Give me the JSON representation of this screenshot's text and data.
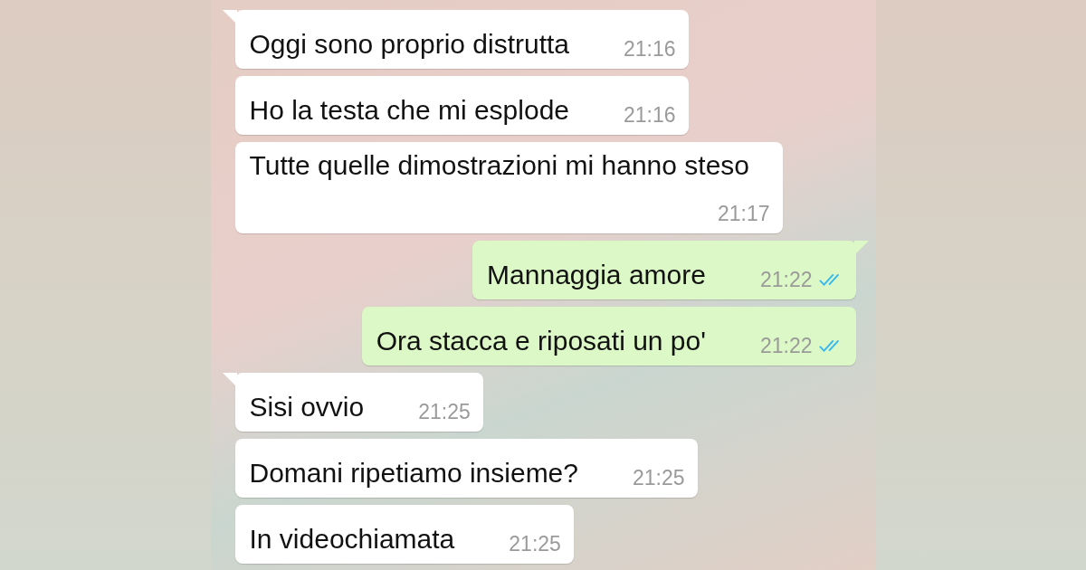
{
  "messages": [
    {
      "kind": "incoming",
      "tail": true,
      "text": "Oggi sono proprio distrutta",
      "time": "21:16"
    },
    {
      "kind": "incoming",
      "tail": false,
      "text": "Ho la testa che mi esplode",
      "time": "21:16"
    },
    {
      "kind": "incoming",
      "tail": false,
      "text": "Tutte quelle dimostrazioni mi hanno steso",
      "time": "21:17"
    },
    {
      "kind": "outgoing",
      "tail": true,
      "text": "Mannaggia amore",
      "time": "21:22",
      "read": true
    },
    {
      "kind": "outgoing",
      "tail": false,
      "text": "Ora stacca e riposati un po'",
      "time": "21:22",
      "read": true
    },
    {
      "kind": "incoming",
      "tail": true,
      "text": "Sisi ovvio",
      "time": "21:25"
    },
    {
      "kind": "incoming",
      "tail": false,
      "text": "Domani ripetiamo insieme?",
      "time": "21:25"
    },
    {
      "kind": "incoming",
      "tail": false,
      "text": "In videochiamata",
      "time": "21:25"
    }
  ]
}
